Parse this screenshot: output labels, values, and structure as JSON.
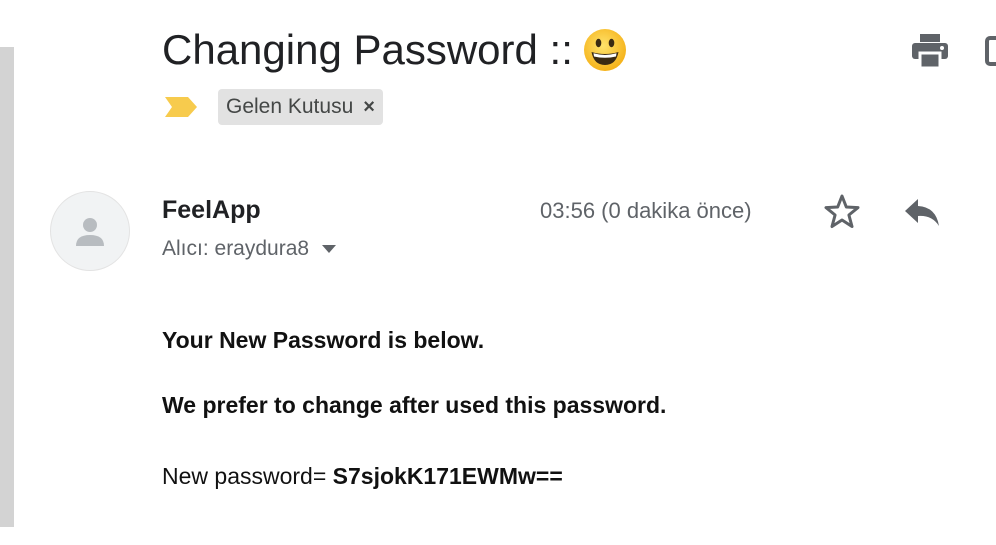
{
  "email": {
    "subject": "Changing Password ::",
    "subject_emoji": "grinning-face-emoji",
    "label": "Gelen Kutusu",
    "label_close": "×",
    "sender": "FeelApp",
    "recipient": "Alıcı: eraydura8",
    "timestamp": "03:56 (0 dakika önce)",
    "body": {
      "line1": "Your New Password is below.",
      "line2": "We prefer to change after used this password.",
      "line3_prefix": "New password=",
      "password": "S7sjokK171EWMw=="
    }
  },
  "icons": {
    "print": "print-icon",
    "new_window": "new-window-icon",
    "importance": "importance-marker-icon",
    "avatar": "person-icon",
    "caret": "caret-down-icon",
    "star": "star-icon",
    "reply": "reply-icon"
  },
  "colors": {
    "importance_marker": "#f7cb4d",
    "label_bg": "#e2e2e2",
    "secondary_text": "#5f6368",
    "icon_gray": "#5f6368"
  }
}
